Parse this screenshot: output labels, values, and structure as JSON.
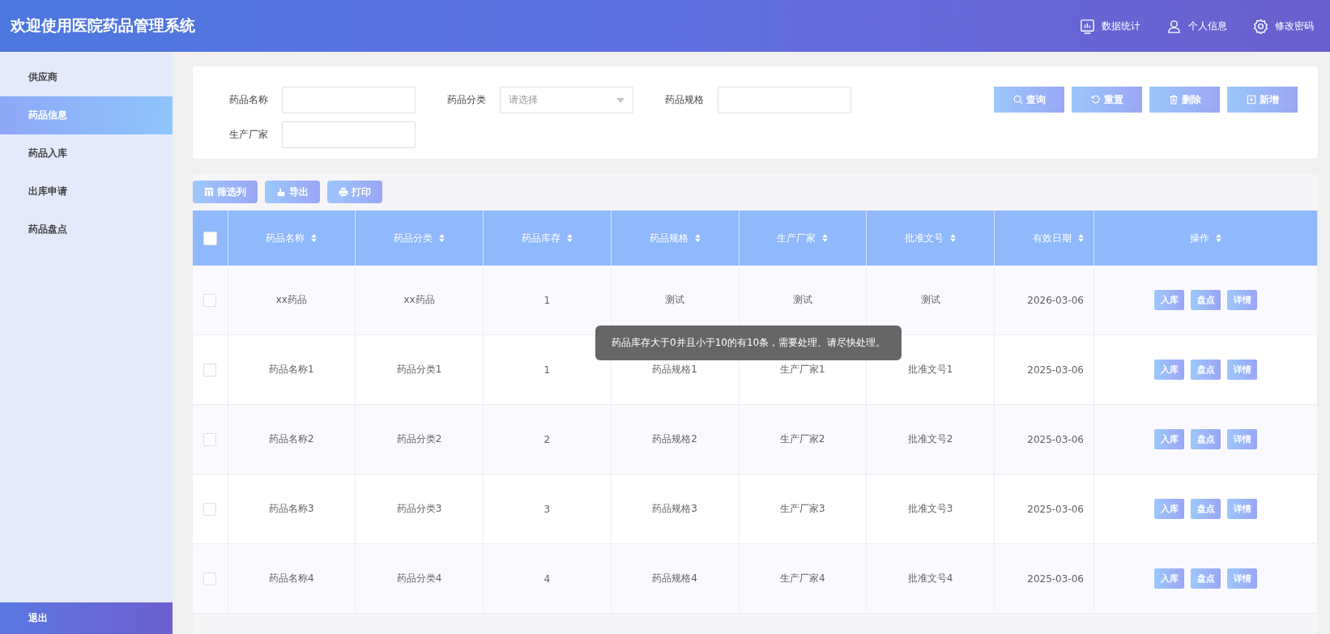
{
  "header": {
    "title": "欢迎使用医院药品管理系统",
    "nav": [
      {
        "label": "数据统计",
        "kind": "chart"
      },
      {
        "label": "个人信息",
        "kind": "user"
      },
      {
        "label": "修改密码",
        "kind": "gear"
      }
    ]
  },
  "sidebar": {
    "items": [
      {
        "label": "供应商",
        "selected": false
      },
      {
        "label": "药品信息",
        "selected": true
      },
      {
        "label": "药品入库",
        "selected": false
      },
      {
        "label": "出库申请",
        "selected": false
      },
      {
        "label": "药品盘点",
        "selected": false
      }
    ],
    "logout": "退出"
  },
  "search": {
    "fields": [
      {
        "label": "药品名称",
        "kind": "text"
      },
      {
        "label": "药品分类",
        "kind": "select",
        "placeholder": "请选择"
      },
      {
        "label": "药品规格",
        "kind": "text"
      },
      {
        "label": "生产厂家",
        "kind": "text"
      }
    ],
    "buttons": [
      {
        "label": "查询",
        "kind": "search"
      },
      {
        "label": "重置",
        "kind": "reset"
      },
      {
        "label": "删除",
        "kind": "trash"
      },
      {
        "label": "新增",
        "kind": "plus"
      }
    ]
  },
  "toolbar": [
    {
      "label": "筛选列",
      "kind": "columns"
    },
    {
      "label": "导出",
      "kind": "export"
    },
    {
      "label": "打印",
      "kind": "print"
    }
  ],
  "table": {
    "select_all": {
      "checked": false
    },
    "columns": [
      "药品名称",
      "药品分类",
      "药品库存",
      "药品规格",
      "生产厂家",
      "批准文号",
      "有效日期",
      "操作"
    ],
    "rows": [
      {
        "checked": false,
        "cells": [
          "xx药品",
          "xx药品",
          "1",
          "测试",
          "测试",
          "测试",
          "2026-03-06"
        ],
        "actions": [
          "入库",
          "盘点",
          "详情"
        ]
      },
      {
        "checked": false,
        "cells": [
          "药品名称1",
          "药品分类1",
          "1",
          "药品规格1",
          "生产厂家1",
          "批准文号1",
          "2025-03-06"
        ],
        "actions": [
          "入库",
          "盘点",
          "详情"
        ]
      },
      {
        "checked": false,
        "cells": [
          "药品名称2",
          "药品分类2",
          "2",
          "药品规格2",
          "生产厂家2",
          "批准文号2",
          "2025-03-06"
        ],
        "actions": [
          "入库",
          "盘点",
          "详情"
        ]
      },
      {
        "checked": false,
        "cells": [
          "药品名称3",
          "药品分类3",
          "3",
          "药品规格3",
          "生产厂家3",
          "批准文号3",
          "2025-03-06"
        ],
        "actions": [
          "入库",
          "盘点",
          "详情"
        ]
      },
      {
        "checked": false,
        "cells": [
          "药品名称4",
          "药品分类4",
          "4",
          "药品规格4",
          "生产厂家4",
          "批准文号4",
          "2025-03-06"
        ],
        "actions": [
          "入库",
          "盘点",
          "详情"
        ]
      }
    ]
  },
  "toast": {
    "text": "药品库存大于0并且小于10的有10条，需要处理、请尽快处理。"
  }
}
